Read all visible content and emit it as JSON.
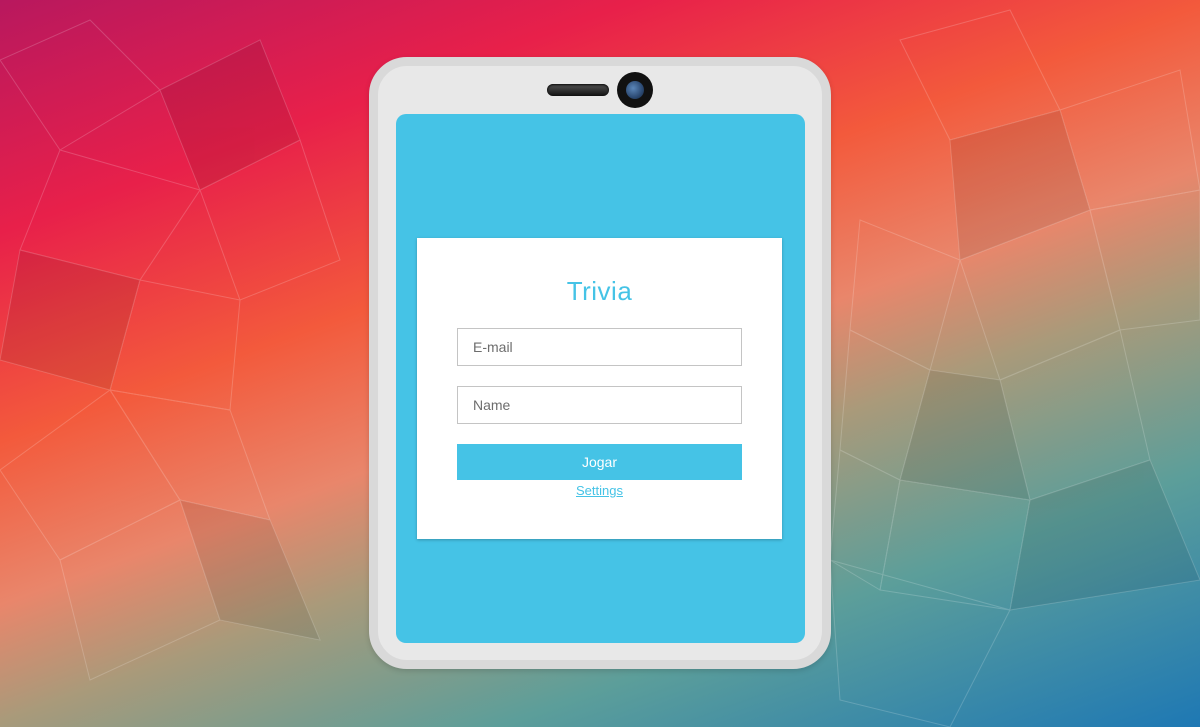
{
  "app": {
    "title": "Trivia"
  },
  "form": {
    "email_placeholder": "E-mail",
    "name_placeholder": "Name",
    "play_button_label": "Jogar",
    "settings_link_label": "Settings"
  },
  "colors": {
    "accent": "#45c3e6",
    "card": "#ffffff",
    "device_frame": "#e8e8e8"
  },
  "icons": {
    "speaker": "speaker-grille-icon",
    "camera": "camera-icon"
  }
}
